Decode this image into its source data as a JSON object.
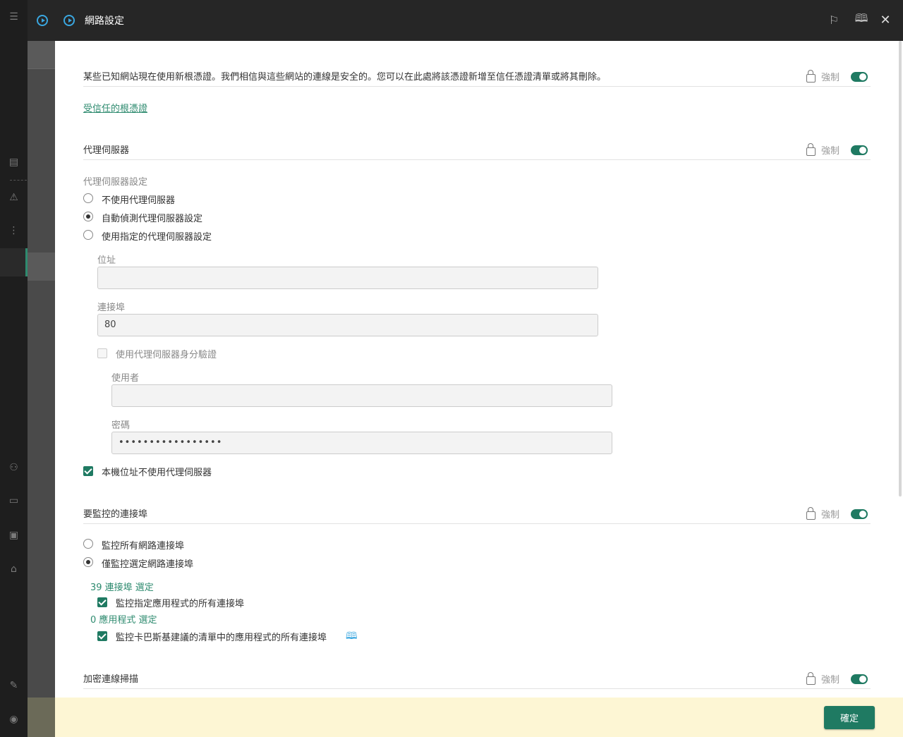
{
  "window": {
    "title": "網路設定"
  },
  "topbar_icons": [
    "flag-icon",
    "book-icon",
    "close-icon"
  ],
  "certs": {
    "description": "某些已知網站現在使用新根憑證。我們相信與這些網站的連線是安全的。您可以在此處將該憑證新增至信任憑證清單或將其刪除。",
    "enforce_label": "強制",
    "link": "受信任的根憑證"
  },
  "proxy": {
    "heading": "代理伺服器",
    "enforce_label": "強制",
    "settings_label": "代理伺服器設定",
    "options": [
      "不使用代理伺服器",
      "自動偵測代理伺服器設定",
      "使用指定的代理伺服器設定"
    ],
    "selected_option": 1,
    "address_label": "位址",
    "address_value": "",
    "port_label": "連接埠",
    "port_value": "80",
    "auth_label": "使用代理伺服器身分驗證",
    "auth_checked": false,
    "user_label": "使用者",
    "user_value": "",
    "password_label": "密碼",
    "password_value": "•••••••••••••••••",
    "bypass_local_label": "本機位址不使用代理伺服器",
    "bypass_local_checked": true
  },
  "ports": {
    "heading": "要監控的連接埠",
    "enforce_label": "強制",
    "options": [
      "監控所有網路連接埠",
      "僅監控選定網路連接埠"
    ],
    "selected_option": 1,
    "ports_selected_link": "39 連接埠 選定",
    "monitor_apps_label": "監控指定應用程式的所有連接埠",
    "monitor_apps_checked": true,
    "apps_selected_link": "0 應用程式 選定",
    "monitor_recommended_label": "監控卡巴斯基建議的清單中的應用程式的所有連接埠",
    "monitor_recommended_checked": true
  },
  "encrypted": {
    "heading": "加密連線掃描",
    "enforce_label": "強制"
  },
  "footer": {
    "ok_label": "確定"
  },
  "colors": {
    "accent": "#1f7a62",
    "link": "#2e8b6f",
    "footer_bg": "#fdf6d4",
    "topbar_icon": "#3aa7e0"
  }
}
